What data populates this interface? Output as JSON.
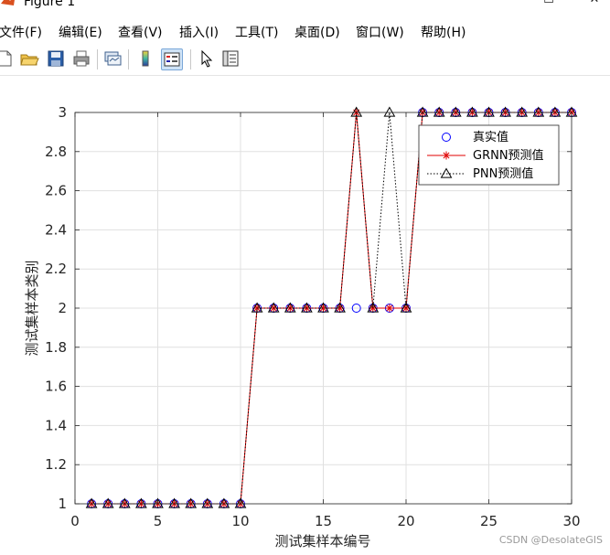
{
  "window": {
    "title": "Figure 1",
    "minimize_label": "—",
    "maximize_label": "☐",
    "close_label": "✕"
  },
  "menu": [
    {
      "label": "文件(F)"
    },
    {
      "label": "编辑(E)"
    },
    {
      "label": "查看(V)"
    },
    {
      "label": "插入(I)"
    },
    {
      "label": "工具(T)"
    },
    {
      "label": "桌面(D)"
    },
    {
      "label": "窗口(W)"
    },
    {
      "label": "帮助(H)"
    }
  ],
  "toolbar": {
    "icons": [
      "new-figure-icon",
      "open-file-icon",
      "save-icon",
      "print-icon",
      "link-plot-icon",
      "insert-colorbar-icon",
      "insert-legend-icon",
      "edit-plot-arrow-icon",
      "property-inspector-icon"
    ],
    "active": "insert-legend-icon"
  },
  "watermark": "CSDN @DesolateGIS",
  "chart_data": {
    "type": "line",
    "title": "",
    "xlabel": "测试集样本编号",
    "ylabel": "测试集样本类别",
    "xlim": [
      0,
      30
    ],
    "ylim": [
      1,
      3
    ],
    "xticks": [
      "0",
      "5",
      "10",
      "15",
      "20",
      "25",
      "30"
    ],
    "yticks": [
      "1",
      "1.2",
      "1.4",
      "1.6",
      "1.8",
      "2",
      "2.2",
      "2.4",
      "2.6",
      "2.8",
      "3"
    ],
    "grid": true,
    "legend_position": "top-right",
    "x": [
      1,
      2,
      3,
      4,
      5,
      6,
      7,
      8,
      9,
      10,
      11,
      12,
      13,
      14,
      15,
      16,
      17,
      18,
      19,
      20,
      21,
      22,
      23,
      24,
      25,
      26,
      27,
      28,
      29,
      30
    ],
    "series": [
      {
        "name": "真实值",
        "style": "markers",
        "marker": "circle",
        "color": "#0000ff",
        "values": [
          1,
          1,
          1,
          1,
          1,
          1,
          1,
          1,
          1,
          1,
          2,
          2,
          2,
          2,
          2,
          2,
          2,
          2,
          2,
          2,
          3,
          3,
          3,
          3,
          3,
          3,
          3,
          3,
          3,
          3
        ]
      },
      {
        "name": "GRNN预测值",
        "style": "solid",
        "marker": "asterisk",
        "color": "#e00000",
        "values": [
          1,
          1,
          1,
          1,
          1,
          1,
          1,
          1,
          1,
          1,
          2,
          2,
          2,
          2,
          2,
          2,
          3,
          2,
          2,
          2,
          3,
          3,
          3,
          3,
          3,
          3,
          3,
          3,
          3,
          3
        ]
      },
      {
        "name": "PNN预测值",
        "style": "dotted",
        "marker": "triangle",
        "color": "#000000",
        "values": [
          1,
          1,
          1,
          1,
          1,
          1,
          1,
          1,
          1,
          1,
          2,
          2,
          2,
          2,
          2,
          2,
          3,
          2,
          3,
          2,
          3,
          3,
          3,
          3,
          3,
          3,
          3,
          3,
          3,
          3
        ]
      }
    ]
  }
}
